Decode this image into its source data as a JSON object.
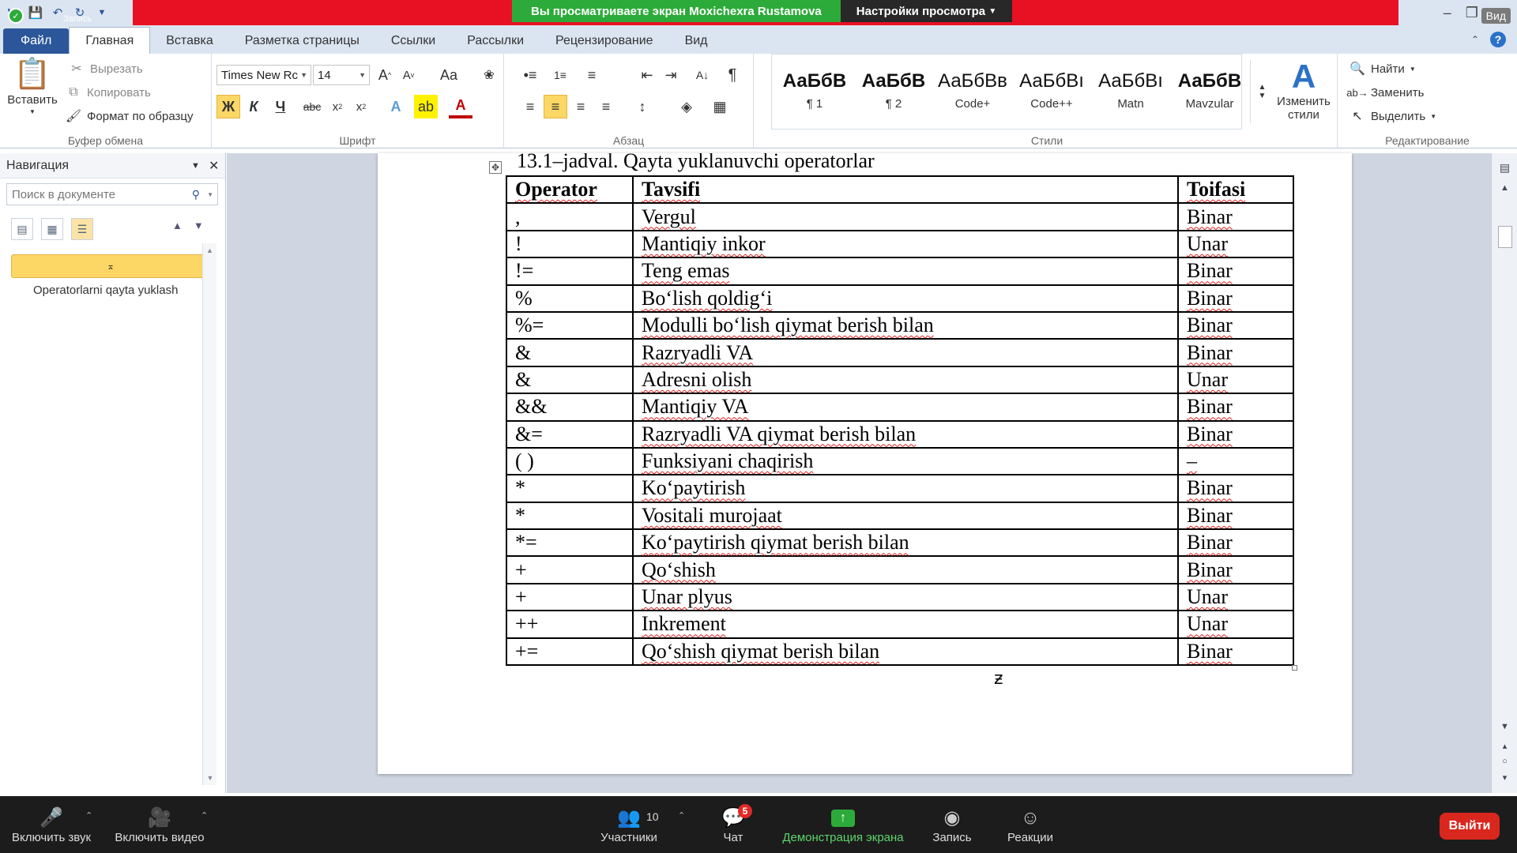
{
  "window": {
    "rec_label": "Запись",
    "view_label": "Вид"
  },
  "share": {
    "message": "Вы просматриваете экран Moxichexra Rustamova",
    "options": "Настройки просмотра"
  },
  "tabs": [
    "Файл",
    "Главная",
    "Вставка",
    "Разметка страницы",
    "Ссылки",
    "Рассылки",
    "Рецензирование",
    "Вид"
  ],
  "clipboard": {
    "paste": "Вставить",
    "cut": "Вырезать",
    "copy": "Копировать",
    "format_painter": "Формат по образцу",
    "label": "Буфер обмена"
  },
  "font": {
    "name": "Times New Rc",
    "size": "14",
    "label": "Шрифт",
    "bold": "Ж",
    "italic": "К",
    "underline": "Ч",
    "strike": "abc",
    "case": "Aa"
  },
  "paragraph": {
    "label": "Абзац"
  },
  "styles": {
    "label": "Стили",
    "items": [
      {
        "preview": "АаБбВ",
        "name": "¶ 1",
        "bold": true
      },
      {
        "preview": "АаБбВ",
        "name": "¶ 2",
        "bold": true
      },
      {
        "preview": "АаБбВв",
        "name": "Code+",
        "bold": false
      },
      {
        "preview": "АаБбВı",
        "name": "Code++",
        "bold": false
      },
      {
        "preview": "АаБбВı",
        "name": "Matn",
        "bold": false
      },
      {
        "preview": "АаБбВ",
        "name": "Mavzular",
        "bold": true
      }
    ],
    "change_styles": "Изменить стили"
  },
  "editing": {
    "find": "Найти",
    "replace": "Заменить",
    "select": "Выделить",
    "label": "Редактирование"
  },
  "nav": {
    "title": "Навигация",
    "search_placeholder": "Поиск в документе",
    "selected": "⌅",
    "item": "Operatorlarni qayta yuklash"
  },
  "document": {
    "caption": "13.1–jadval. Qayta yuklanuvchi operatorlar",
    "headers": [
      "Operator",
      "Tavsifi",
      "Toifasi"
    ],
    "rows": [
      [
        ",",
        "Vergul",
        "Binar"
      ],
      [
        "!",
        "Mantiqiy inkor",
        "Unar"
      ],
      [
        "!=",
        "Teng emas",
        "Binar"
      ],
      [
        "%",
        "Bo‘lish qoldig‘i",
        "Binar"
      ],
      [
        "%=",
        "Modulli bo‘lish qiymat berish bilan",
        "Binar"
      ],
      [
        "&",
        "Razryadli VA",
        "Binar"
      ],
      [
        "&",
        "Adresni olish",
        "Unar"
      ],
      [
        "&&",
        "Mantiqiy VA",
        "Binar"
      ],
      [
        "&=",
        "Razryadli VA qiymat berish bilan",
        "Binar"
      ],
      [
        "( )",
        "Funksiyani chaqirish",
        "–"
      ],
      [
        "*",
        "Ko‘paytirish",
        "Binar"
      ],
      [
        "*",
        "Vositali murojaat",
        "Binar"
      ],
      [
        "*=",
        "Ko‘paytirish qiymat berish bilan",
        "Binar"
      ],
      [
        "+",
        "Qo‘shish",
        "Binar"
      ],
      [
        "+",
        "Unar plyus",
        "Unar"
      ],
      [
        "++",
        "Inkrement",
        "Unar"
      ],
      [
        "+=",
        "Qo‘shish qiymat berish bilan",
        "Binar"
      ]
    ]
  },
  "zoom": {
    "unmute": "Включить звук",
    "video": "Включить видео",
    "participants": "Участники",
    "participants_count": "10",
    "chat": "Чат",
    "chat_badge": "5",
    "share": "Демонстрация экрана",
    "record": "Запись",
    "reactions": "Реакции",
    "leave": "Выйти"
  }
}
